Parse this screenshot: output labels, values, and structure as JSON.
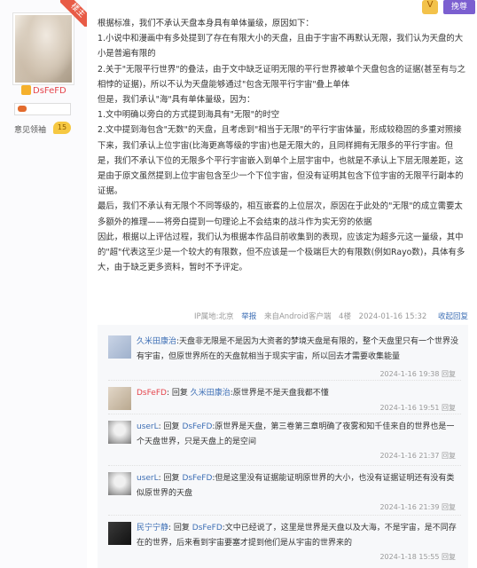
{
  "author": {
    "badge": "楼主",
    "name": "DsFeFD",
    "leader_label": "意见领袖",
    "leader_level": "15"
  },
  "top": {
    "vip": "V",
    "wan_label": "挽尊"
  },
  "post": {
    "lines": [
      "根据标准，我们不承认天盘本身具有单体量级，原因如下：",
      "1.小说中和漫画中有多处提到了存在有限大小的天盘，且由于宇宙不再默认无限，我们认为天盘的大小是普遍有限的",
      "2.关于\"无限平行世界\"的叠法，由于文中缺乏证明无限的平行世界被单个天盘包含的证据(甚至有与之相悖的证据)，所以不认为天盘能够通过\"包含无限平行宇宙\"叠上单体",
      "但是，我们承认\"海\"具有单体量级，因为：",
      "1.文中明确以旁白的方式提到海具有\"无限\"的时空",
      "2.文中提到海包含\"无数\"的天盘，且考虑到\"相当于无限\"的平行宇宙体量，形成较稳固的多重对照接下来，我们承认上位宇宙(比海更高等级的宇宙)也是无限大的，且同样拥有无限多的平行宇宙。但是，我们不承认下位的无限多个平行宇宙嵌入到单个上层宇宙中，也就是不承认上下层无限差距，这是由于原文虽然提到上位宇宙包含至少一个下位宇宙，但没有证明其包含下位宇宙的无限平行副本的证据。",
      "最后，我们不承认有无限个不同等级的，相互嵌套的上位层次，原因在于此处的\"无限\"的成立需要太多额外的推理——将旁白提到一句理论上不会结束的战斗作为实无穷的依据",
      "因此，根据以上评估过程，我们认为根据本作品目前收集到的表现，应该定为超多元这一量级，其中的\"超\"代表这至少是一个较大的有限数，但不应该是一个极端巨大的有限数(例如Rayo数)，具体有多大，由于缺乏更多资料，暂时不予评定。"
    ]
  },
  "meta": {
    "ip": "IP属地:北京",
    "report": "举报",
    "client": "来自Android客户端",
    "floor": "4楼",
    "time": "2024-01-16 15:32",
    "fold": "收起回复"
  },
  "replies": [
    {
      "name": "久米田康治",
      "text": ":天盘非无限是不是因为大资者的梦境天盘是有限的，整个天盘里只有一个世界没有宇宙，但原世界所在的天盘就相当于现实宇宙，所以回去才需要收集能量",
      "time": "2024-1-16 19:38",
      "reply": "回复"
    },
    {
      "name": "DsFeFD",
      "prefix": ": 回复",
      "target": "久米田康治",
      "text": ":原世界是不是天盘我都不懂",
      "time": "2024-1-16 19:51",
      "reply": "回复"
    },
    {
      "name": "userL",
      "prefix": ": 回复",
      "target": "DsFeFD",
      "text": ":原世界是天盘，第三卷第三章明确了夜雾和知千佳来自的世界也是一个天盘世界，只是天盘上的是空间",
      "time": "2024-1-16 21:37",
      "reply": "回复"
    },
    {
      "name": "userL",
      "prefix": ": 回复",
      "target": "DsFeFD",
      "text": ":但是这里没有证据能证明原世界的大小，也没有证据证明还有没有类似原世界的天盘",
      "time": "2024-1-16 21:39",
      "reply": "回复"
    },
    {
      "name": "民宁宁静",
      "prefix": ": 回复",
      "target": "DsFeFD",
      "text": ":文中已经说了，这里是世界是天盘以及大海，不是宇宙，是不同存在的世界，后来看到宇宙要塞才提到他们是从宇宙的世界来的",
      "time": "2024-1-18 15:55",
      "reply": "回复"
    }
  ]
}
